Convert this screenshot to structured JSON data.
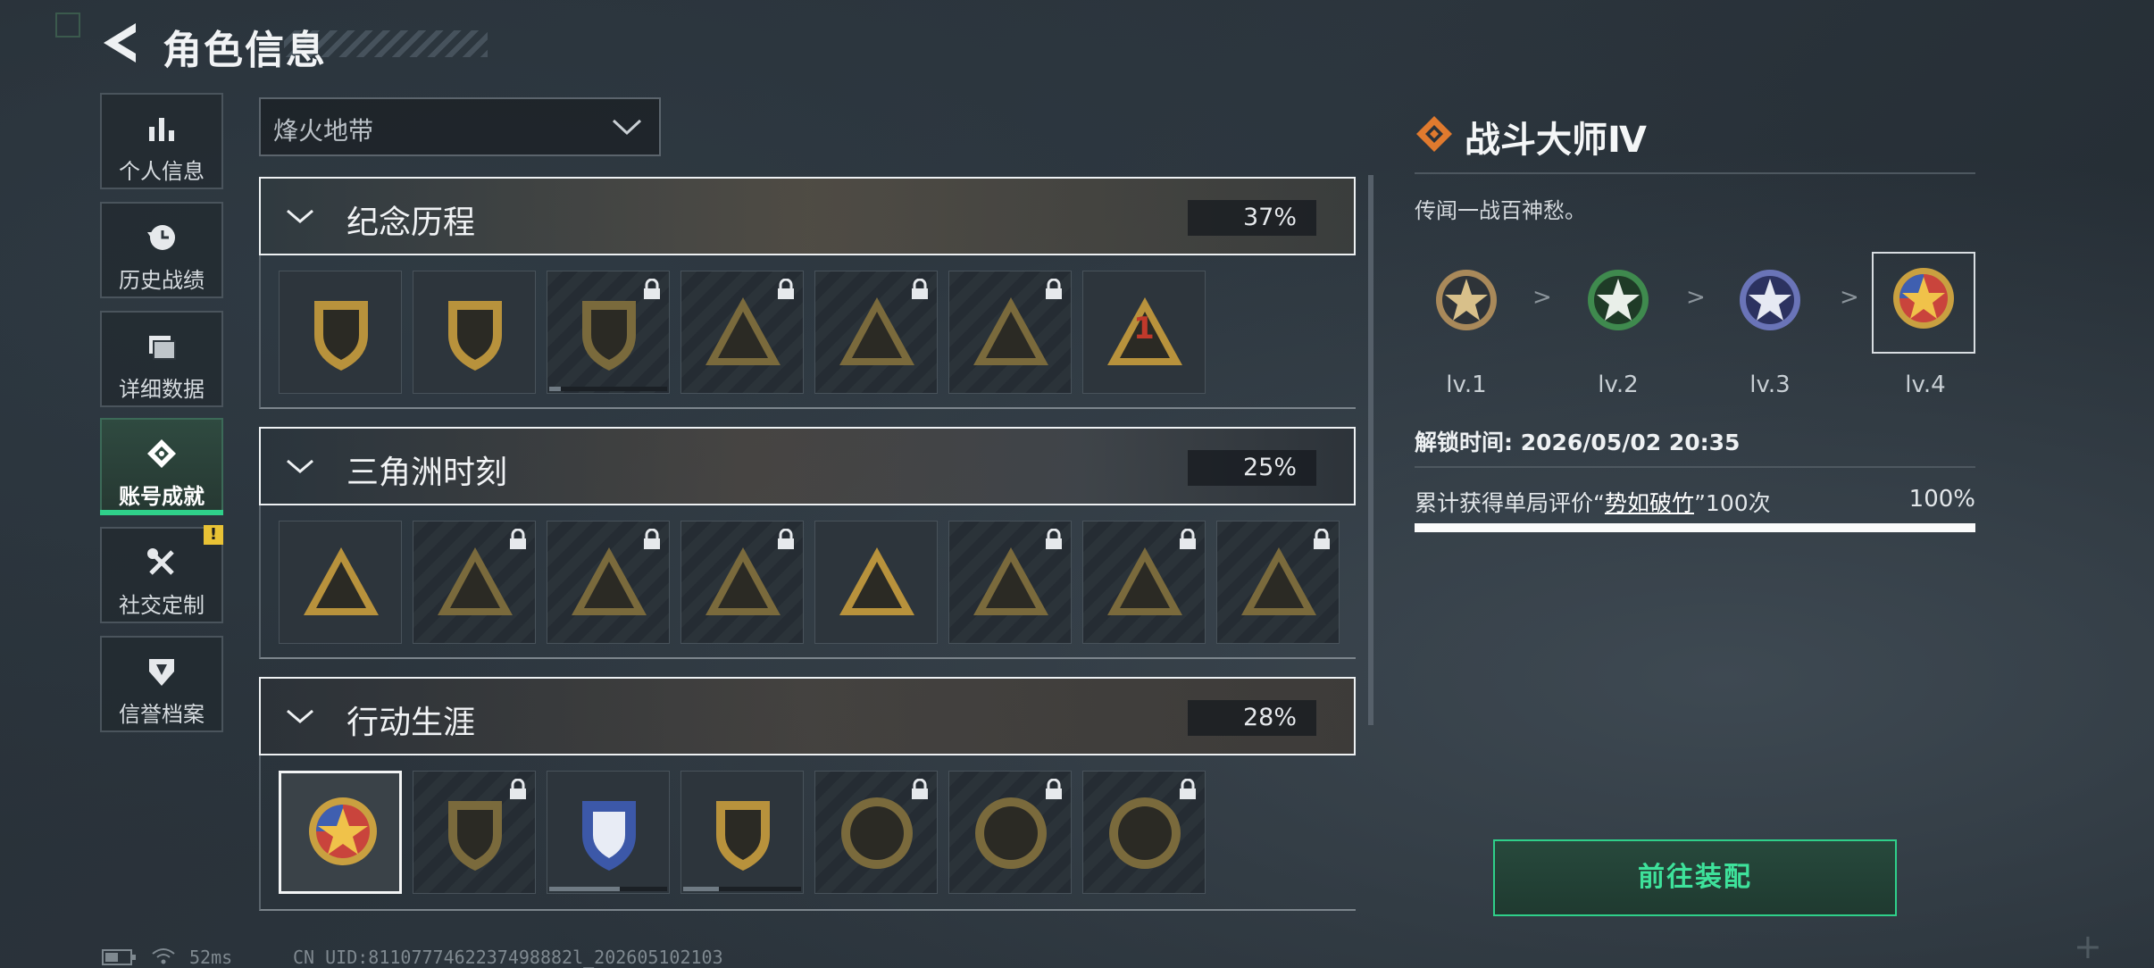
{
  "header": {
    "title": "角色信息"
  },
  "sidebar": {
    "items": [
      {
        "label": "个人信息",
        "icon": "bar-chart-icon"
      },
      {
        "label": "历史战绩",
        "icon": "history-clock-icon"
      },
      {
        "label": "详细数据",
        "icon": "folder-icon"
      },
      {
        "label": "账号成就",
        "icon": "achievement-icon",
        "active": true
      },
      {
        "label": "社交定制",
        "icon": "tools-icon",
        "badge": "!"
      },
      {
        "label": "信誉档案",
        "icon": "credit-shield-icon"
      }
    ]
  },
  "mode_select": {
    "value": "烽火地带"
  },
  "categories": [
    {
      "name": "纪念历程",
      "percent": "37%",
      "badges": [
        {
          "icon": "triangle-emblem-icon",
          "locked": false
        },
        {
          "icon": "helicopter-emblem-icon",
          "locked": false
        },
        {
          "icon": "shield-emblem-icon",
          "locked": true,
          "progress": 0.1
        },
        {
          "icon": "soldier-emblem-icon",
          "locked": true
        },
        {
          "icon": "wings-emblem-icon",
          "locked": true
        },
        {
          "icon": "crossed-swords-emblem-icon",
          "locked": true
        },
        {
          "icon": "number-one-emblem-icon",
          "locked": false,
          "text": "1"
        }
      ]
    },
    {
      "name": "三角洲时刻",
      "percent": "25%",
      "badges": [
        {
          "icon": "drive-emblem-icon",
          "locked": false
        },
        {
          "icon": "door-emblem-icon",
          "locked": true
        },
        {
          "icon": "runner-emblem-icon",
          "locked": true
        },
        {
          "icon": "gem-emblem-icon",
          "locked": true
        },
        {
          "icon": "squad-emblem-icon",
          "locked": false
        },
        {
          "icon": "team-emblem-icon",
          "locked": true
        },
        {
          "icon": "bird-emblem-icon",
          "locked": true
        },
        {
          "icon": "rose-emblem-icon",
          "locked": true
        }
      ]
    },
    {
      "name": "行动生涯",
      "percent": "28%",
      "badges": [
        {
          "icon": "star-medal-icon",
          "locked": false,
          "selected": true
        },
        {
          "icon": "wing-shield-emblem-icon",
          "locked": true
        },
        {
          "icon": "blue-shield-emblem-icon",
          "locked": false,
          "progress": 0.6
        },
        {
          "icon": "gem-shield-emblem-icon",
          "locked": false,
          "progress": 0.3
        },
        {
          "icon": "ring-emblem-icon",
          "locked": true
        },
        {
          "icon": "skull-emblem-icon",
          "locked": true
        },
        {
          "icon": "eye-emblem-icon",
          "locked": true
        }
      ]
    }
  ],
  "detail": {
    "title": "战斗大师Ⅳ",
    "description": "传闻一战百神愁。",
    "levels": [
      {
        "label": "lv.1",
        "color": "#a9895a"
      },
      {
        "label": "lv.2",
        "color": "#3f8a4e"
      },
      {
        "label": "lv.3",
        "color": "#6a74b8"
      },
      {
        "label": "lv.4",
        "color": "#c9443c",
        "current": true
      }
    ],
    "level_separator": ">",
    "unlock_label": "解锁时间:",
    "unlock_time": "2026/05/02 20:35",
    "requirement_prefix": "累计获得单局评价“",
    "requirement_highlight": "势如破竹",
    "requirement_suffix": "”100次",
    "requirement_percent": "100%",
    "requirement_progress": 1.0,
    "equip_label": "前往装配"
  },
  "status_bar": {
    "ping": "52ms",
    "uid": "CN UID:8110777462237498882l_202605102103"
  },
  "colors": {
    "accent": "#2fd08a",
    "gold": "#b8923c",
    "badge_yellow": "#e8c235"
  }
}
